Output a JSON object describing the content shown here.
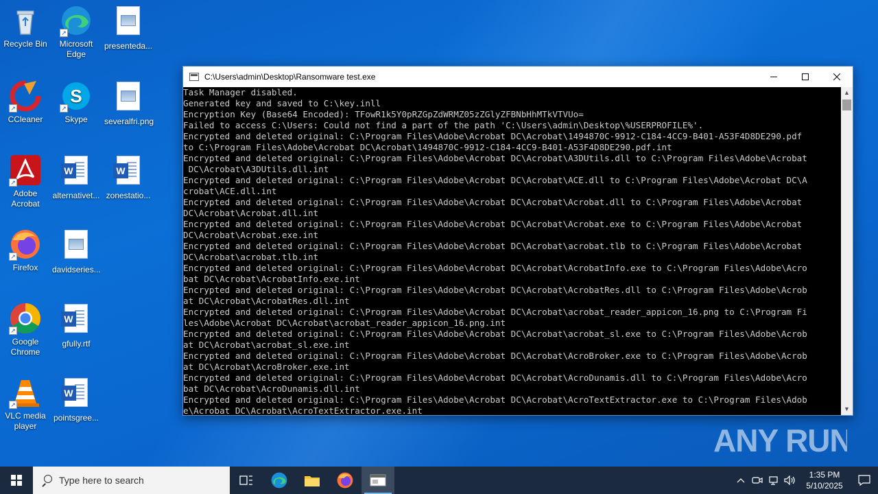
{
  "desktop": {
    "icons": [
      {
        "label": "Recycle Bin"
      },
      {
        "label": "Microsoft Edge"
      },
      {
        "label": "presenteda..."
      },
      {
        "label": "CCleaner"
      },
      {
        "label": "Skype"
      },
      {
        "label": "severalfri.png"
      },
      {
        "label": "Adobe Acrobat"
      },
      {
        "label": "alternativet..."
      },
      {
        "label": "zonestatio..."
      },
      {
        "label": "Firefox"
      },
      {
        "label": "davidseries..."
      },
      {
        "label": "Google Chrome"
      },
      {
        "label": "gfully.rtf"
      },
      {
        "label": "VLC media player"
      },
      {
        "label": "pointsgree..."
      }
    ]
  },
  "console": {
    "title": "C:\\Users\\admin\\Desktop\\Ransomware test.exe",
    "lines": [
      "Task Manager disabled.",
      "Generated key and saved to C:\\key.inll",
      "Encryption Key (Base64 Encoded): TFowR1k5Y0pRZGpZdWRMZ05zZGlyZFBNbHhMTkVTVUo=",
      "Failed to access C:\\Users: Could not find a part of the path 'C:\\Users\\admin\\Desktop\\%USERPROFILE%'.",
      "Encrypted and deleted original: C:\\Program Files\\Adobe\\Acrobat DC\\Acrobat\\1494870C-9912-C184-4CC9-B401-A53F4D8DE290.pdf",
      "to C:\\Program Files\\Adobe\\Acrobat DC\\Acrobat\\1494870C-9912-C184-4CC9-B401-A53F4D8DE290.pdf.int",
      "Encrypted and deleted original: C:\\Program Files\\Adobe\\Acrobat DC\\Acrobat\\A3DUtils.dll to C:\\Program Files\\Adobe\\Acrobat",
      " DC\\Acrobat\\A3DUtils.dll.int",
      "Encrypted and deleted original: C:\\Program Files\\Adobe\\Acrobat DC\\Acrobat\\ACE.dll to C:\\Program Files\\Adobe\\Acrobat DC\\A",
      "crobat\\ACE.dll.int",
      "Encrypted and deleted original: C:\\Program Files\\Adobe\\Acrobat DC\\Acrobat\\Acrobat.dll to C:\\Program Files\\Adobe\\Acrobat",
      "DC\\Acrobat\\Acrobat.dll.int",
      "Encrypted and deleted original: C:\\Program Files\\Adobe\\Acrobat DC\\Acrobat\\Acrobat.exe to C:\\Program Files\\Adobe\\Acrobat",
      "DC\\Acrobat\\Acrobat.exe.int",
      "Encrypted and deleted original: C:\\Program Files\\Adobe\\Acrobat DC\\Acrobat\\acrobat.tlb to C:\\Program Files\\Adobe\\Acrobat",
      "DC\\Acrobat\\acrobat.tlb.int",
      "Encrypted and deleted original: C:\\Program Files\\Adobe\\Acrobat DC\\Acrobat\\AcrobatInfo.exe to C:\\Program Files\\Adobe\\Acro",
      "bat DC\\Acrobat\\AcrobatInfo.exe.int",
      "Encrypted and deleted original: C:\\Program Files\\Adobe\\Acrobat DC\\Acrobat\\AcrobatRes.dll to C:\\Program Files\\Adobe\\Acrob",
      "at DC\\Acrobat\\AcrobatRes.dll.int",
      "Encrypted and deleted original: C:\\Program Files\\Adobe\\Acrobat DC\\Acrobat\\acrobat_reader_appicon_16.png to C:\\Program Fi",
      "les\\Adobe\\Acrobat DC\\Acrobat\\acrobat_reader_appicon_16.png.int",
      "Encrypted and deleted original: C:\\Program Files\\Adobe\\Acrobat DC\\Acrobat\\acrobat_sl.exe to C:\\Program Files\\Adobe\\Acrob",
      "at DC\\Acrobat\\acrobat_sl.exe.int",
      "Encrypted and deleted original: C:\\Program Files\\Adobe\\Acrobat DC\\Acrobat\\AcroBroker.exe to C:\\Program Files\\Adobe\\Acrob",
      "at DC\\Acrobat\\AcroBroker.exe.int",
      "Encrypted and deleted original: C:\\Program Files\\Adobe\\Acrobat DC\\Acrobat\\AcroDunamis.dll to C:\\Program Files\\Adobe\\Acro",
      "bat DC\\Acrobat\\AcroDunamis.dll.int",
      "Encrypted and deleted original: C:\\Program Files\\Adobe\\Acrobat DC\\Acrobat\\AcroTextExtractor.exe to C:\\Program Files\\Adob",
      "e\\Acrobat DC\\Acrobat\\AcroTextExtractor.exe.int"
    ]
  },
  "watermark": {
    "text": "ANY RUN"
  },
  "taskbar": {
    "search_placeholder": "Type here to search",
    "clock_time": "1:35 PM",
    "clock_date": "5/10/2025"
  },
  "colors": {
    "desktop_bg": "#0a67cf",
    "taskbar_bg": "#1b2a3e",
    "console_text": "#cccccc",
    "console_bg": "#000000"
  }
}
